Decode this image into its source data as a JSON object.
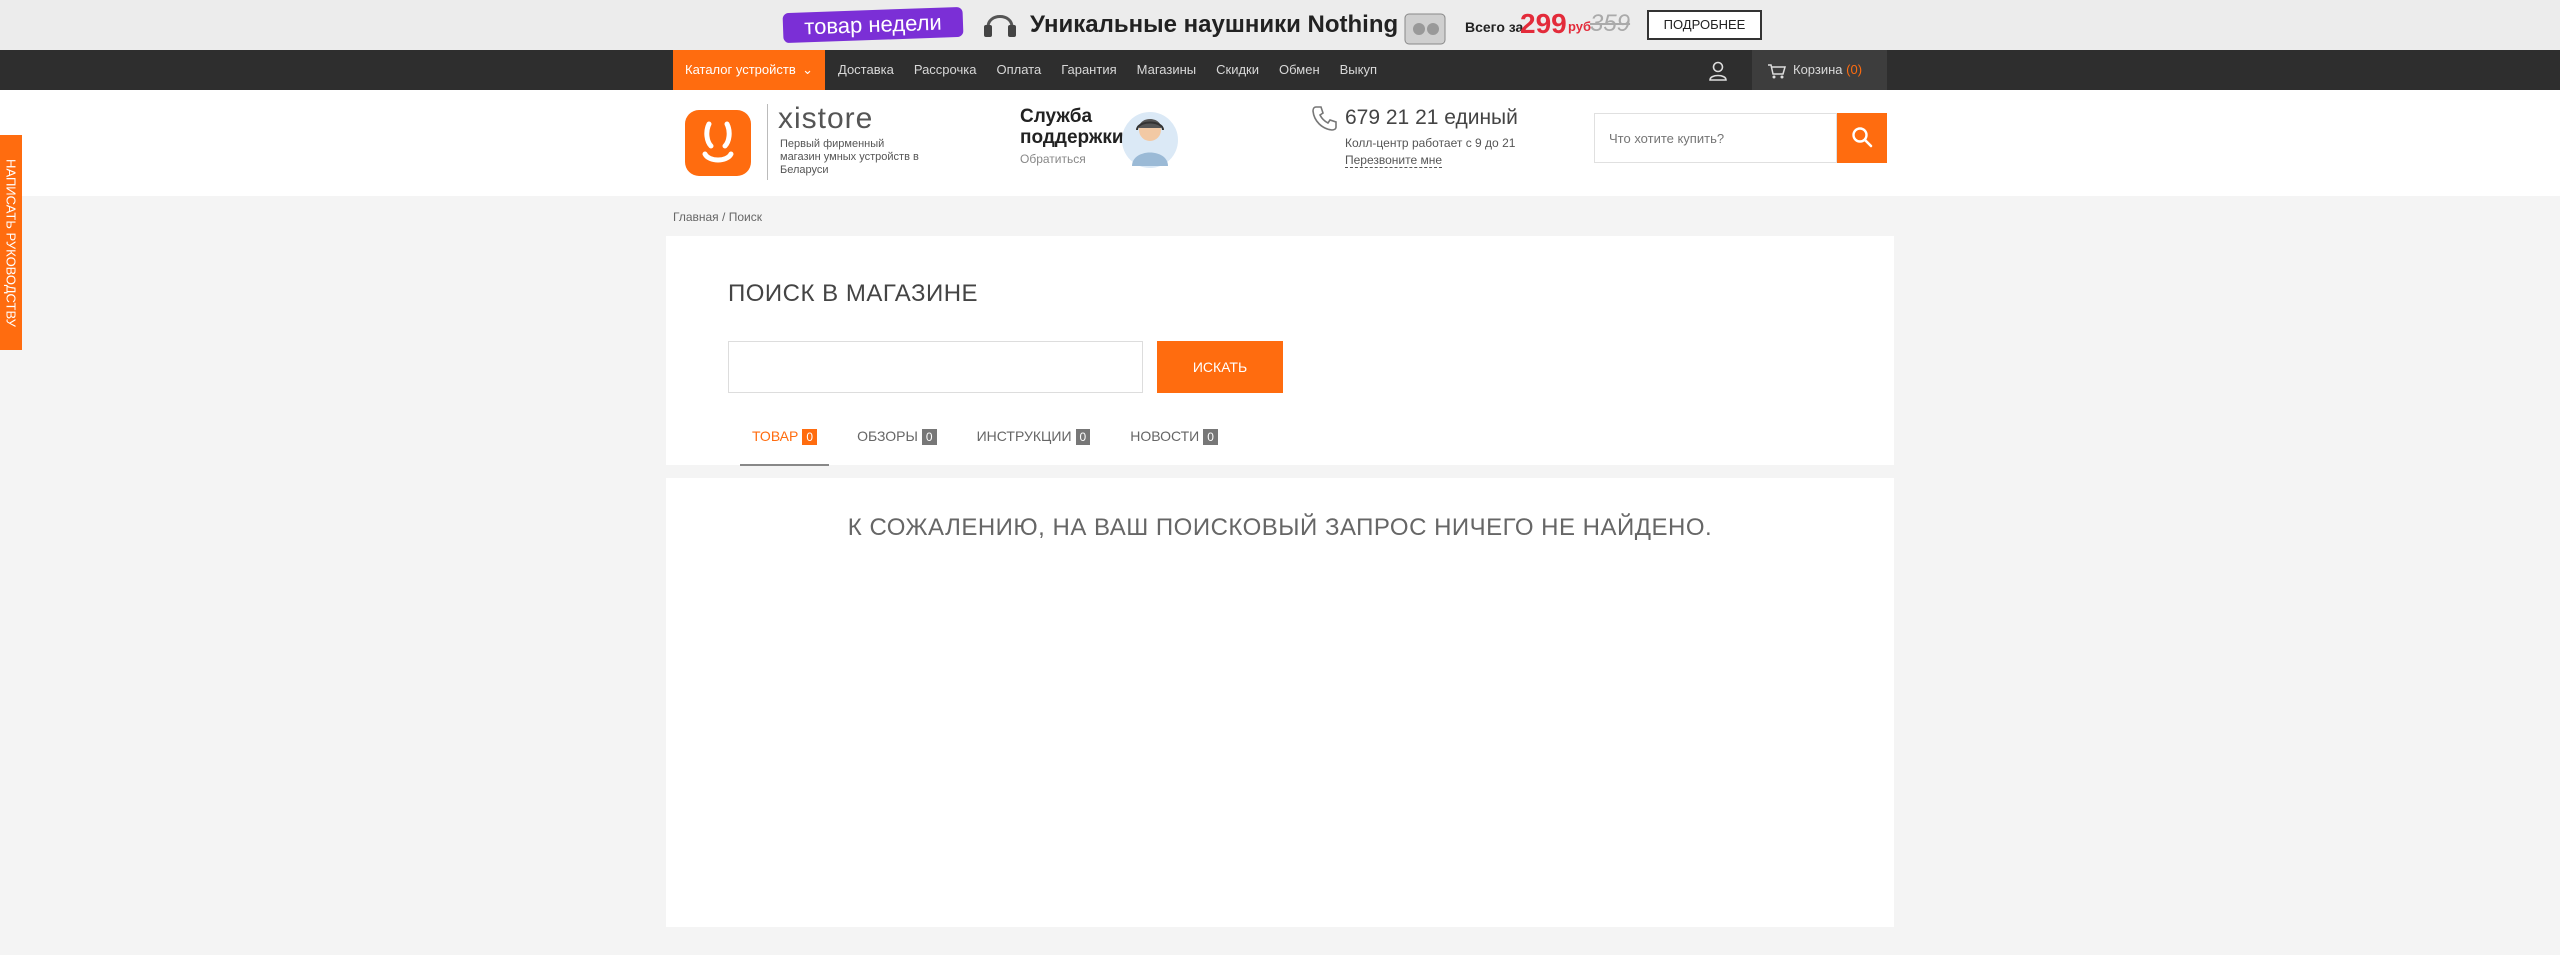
{
  "promo": {
    "badge": "товар недели",
    "title": "Уникальные наушники Nothing",
    "price_prefix": "Всего за",
    "price": "299",
    "currency": "руб",
    "old_price": "359",
    "button": "ПОДРОБНЕЕ",
    "badge_color": "#7b2fd6"
  },
  "nav": {
    "catalog": "Каталог устройств",
    "links": [
      "Доставка",
      "Рассрочка",
      "Оплата",
      "Гарантия",
      "Магазины",
      "Скидки",
      "Обмен",
      "Выкуп"
    ],
    "cart_label": "Корзина",
    "cart_count": "(0)"
  },
  "header": {
    "logo_text": "xistore",
    "logo_sub": "Первый фирменный магазин умных устройств в Беларуси",
    "support_title": "Служба поддержки",
    "support_link": "Обратиться",
    "phone": "679 21 21 единый",
    "phone_note": "Колл-центр работает с 9 до 21",
    "callback": "Перезвоните мне",
    "search_placeholder": "Что хотите купить?"
  },
  "sidetab": "НАПИСАТЬ РУКОВОДСТВУ",
  "breadcrumb": {
    "home": "Главная",
    "sep": " / ",
    "current": "Поиск"
  },
  "search": {
    "title": "ПОИСК В МАГАЗИНЕ",
    "input_value": "",
    "button": "ИСКАТЬ",
    "tabs": [
      {
        "label": "ТОВАР",
        "count": "0"
      },
      {
        "label": "ОБЗОРЫ",
        "count": "0"
      },
      {
        "label": "ИНСТРУКЦИИ",
        "count": "0"
      },
      {
        "label": "НОВОСТИ",
        "count": "0"
      }
    ]
  },
  "results": {
    "message": "К СОЖАЛЕНИЮ, НА ВАШ ПОИСКОВЫЙ ЗАПРОС НИЧЕГО НЕ НАЙДЕНО."
  },
  "colors": {
    "accent": "#ff6c0f",
    "nav_bg": "#2e2e2e",
    "page_bg": "#f4f4f4"
  }
}
